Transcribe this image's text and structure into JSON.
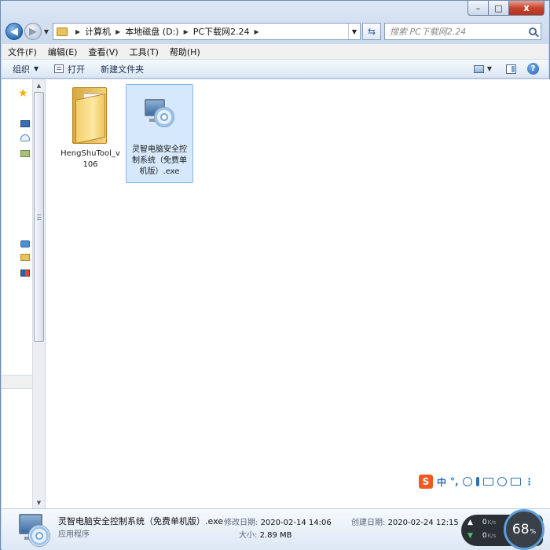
{
  "window": {
    "controls": {
      "minimize": "–",
      "maximize": "□",
      "close": "x"
    }
  },
  "address_bar": {
    "breadcrumbs": [
      "计算机",
      "本地磁盘 (D:)",
      "PC下载网2.24"
    ]
  },
  "search": {
    "placeholder": "搜索 PC下载网2.24"
  },
  "menu": [
    "文件(F)",
    "编辑(E)",
    "查看(V)",
    "工具(T)",
    "帮助(H)"
  ],
  "command_bar": {
    "organize": "组织",
    "open": "打开",
    "new_folder": "新建文件夹",
    "help": "?"
  },
  "files": [
    {
      "name": "HengShuTool_v106",
      "type": "folder",
      "selected": false
    },
    {
      "name": "灵智电脑安全控制系统（免费单机版）.exe",
      "type": "application",
      "selected": true
    }
  ],
  "ime": {
    "logo": "S",
    "mode": "中"
  },
  "details": {
    "name": "灵智电脑安全控制系统（免费单机版）.exe",
    "type": "应用程序",
    "modified_label": "修改日期:",
    "modified": "2020-02-14 14:06",
    "size_label": "大小:",
    "size": "2.89 MB",
    "created_label": "创建日期:",
    "created": "2020-02-24 12:15"
  },
  "net_widget": {
    "up": "0",
    "down": "0",
    "unit": "K/s",
    "percent": "68",
    "percent_unit": "%"
  }
}
